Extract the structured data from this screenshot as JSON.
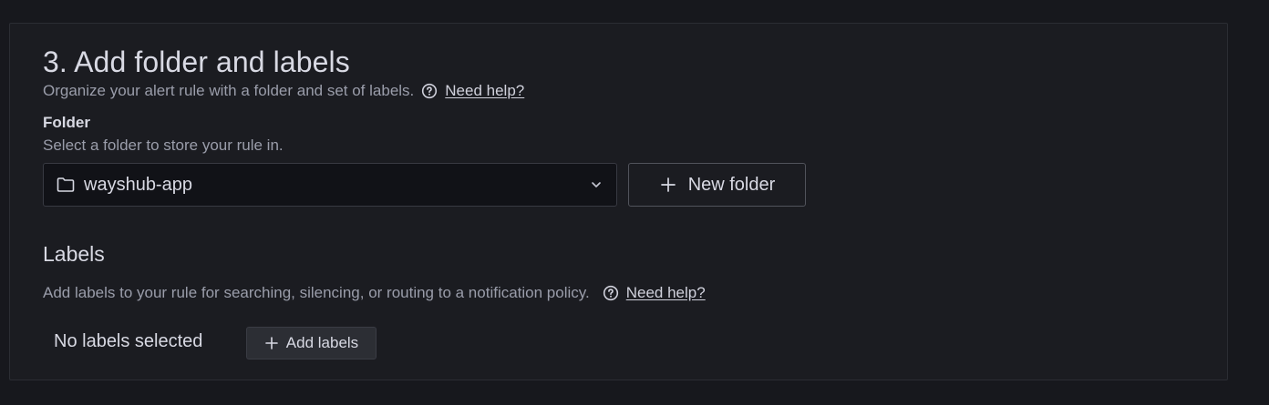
{
  "section": {
    "title": "3. Add folder and labels",
    "description": "Organize your alert rule with a folder and set of labels.",
    "help_link": "Need help?"
  },
  "folder": {
    "label": "Folder",
    "description": "Select a folder to store your rule in.",
    "selected_value": "wayshub-app",
    "new_folder_label": "New folder"
  },
  "labels": {
    "title": "Labels",
    "description": "Add labels to your rule for searching, silencing, or routing to a notification policy.",
    "help_link": "Need help?",
    "empty_state": "No labels selected",
    "add_button_label": "Add labels"
  },
  "icons": {
    "help": "question-circle-icon",
    "folder": "folder-icon",
    "dropdown": "chevron-down-icon",
    "add": "plus-icon"
  },
  "colors": {
    "page_background": "#17181d",
    "card_background": "#1b1c21",
    "text_primary": "#d8d9e3",
    "text_secondary": "#9a9daa"
  }
}
